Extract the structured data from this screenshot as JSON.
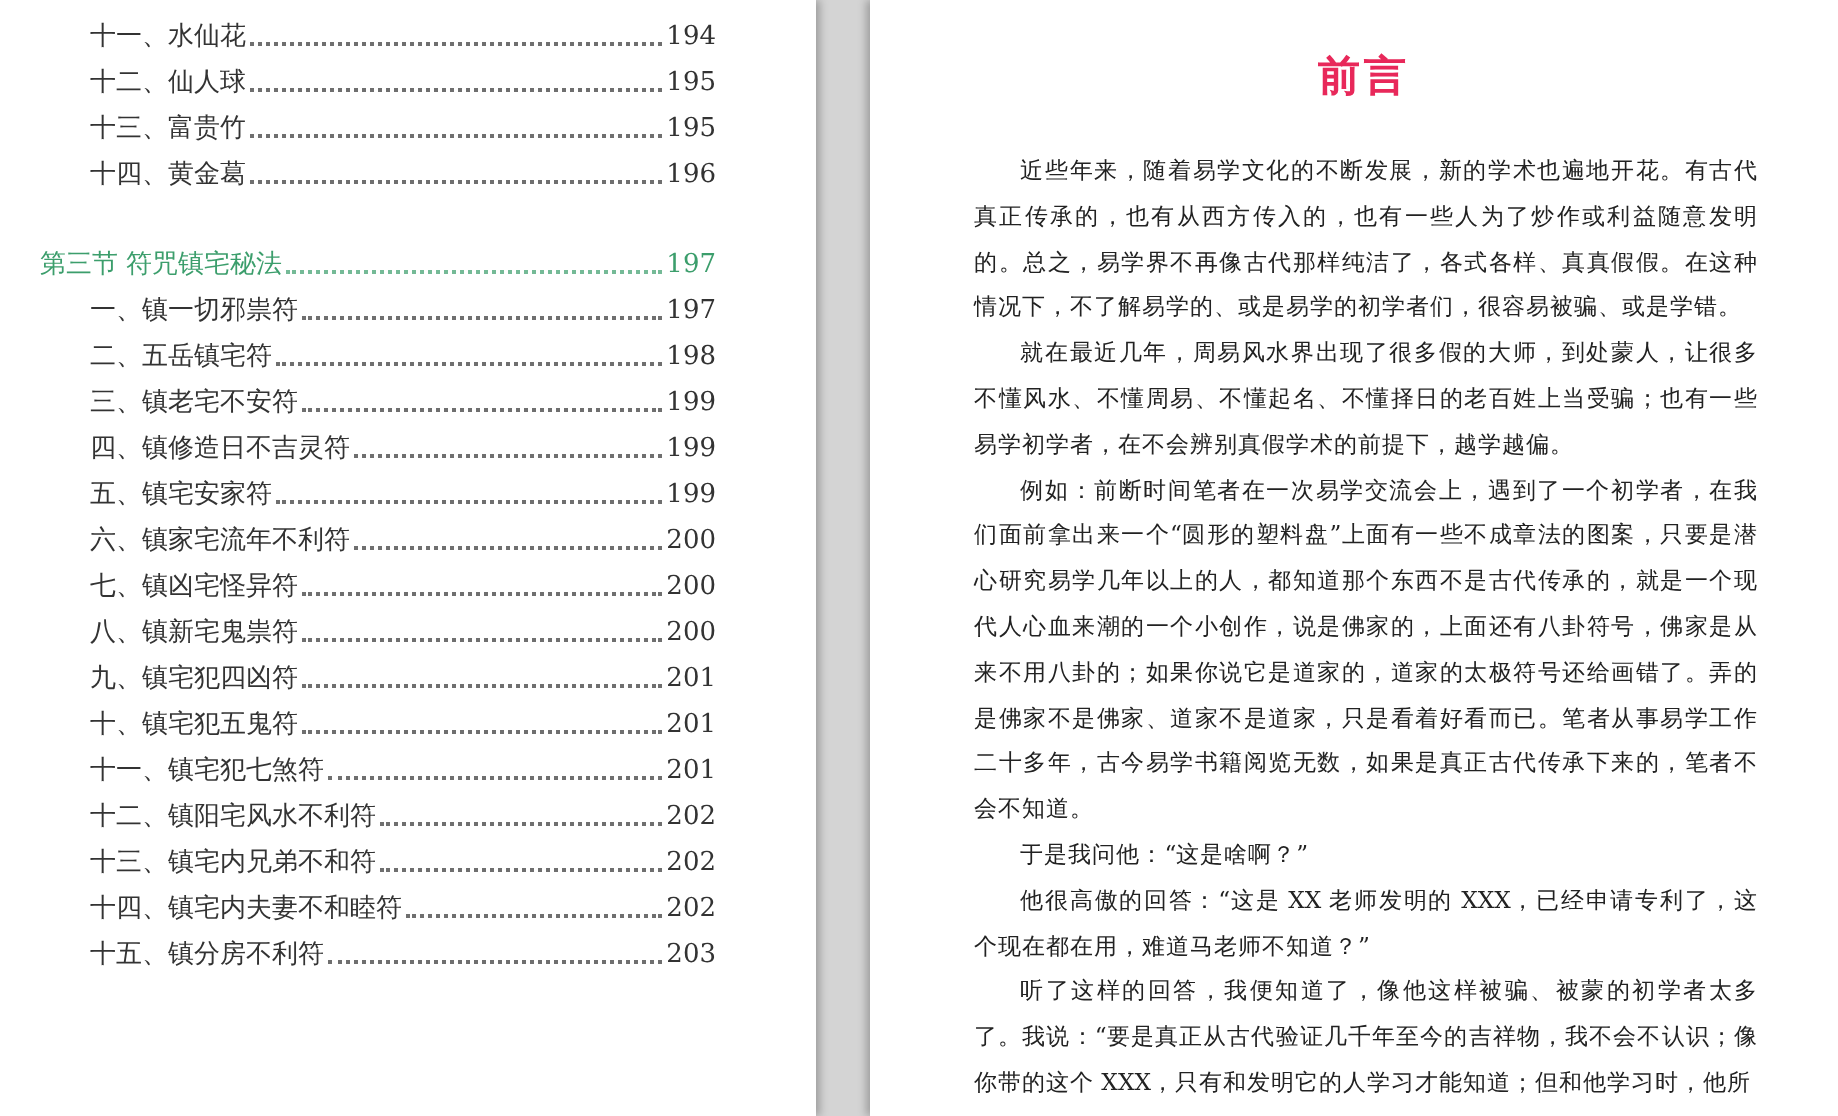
{
  "toc": [
    {
      "kind": "item",
      "title": "十一、水仙花",
      "page": "194"
    },
    {
      "kind": "item",
      "title": "十二、仙人球",
      "page": "195"
    },
    {
      "kind": "item",
      "title": "十三、富贵竹",
      "page": "195"
    },
    {
      "kind": "item",
      "title": "十四、黄金葛",
      "page": "196"
    },
    {
      "kind": "section",
      "title": "第三节  符咒镇宅秘法",
      "page": "197",
      "children": [
        {
          "kind": "item",
          "title": "一、镇一切邪祟符",
          "page": "197"
        },
        {
          "kind": "item",
          "title": "二、五岳镇宅符",
          "page": "198"
        },
        {
          "kind": "item",
          "title": "三、镇老宅不安符",
          "page": "199"
        },
        {
          "kind": "item",
          "title": "四、镇修造日不吉灵符",
          "page": "199"
        },
        {
          "kind": "item",
          "title": "五、镇宅安家符",
          "page": "199"
        },
        {
          "kind": "item",
          "title": "六、镇家宅流年不利符",
          "page": "200"
        },
        {
          "kind": "item",
          "title": "七、镇凶宅怪异符",
          "page": "200"
        },
        {
          "kind": "item",
          "title": "八、镇新宅鬼祟符",
          "page": "200"
        },
        {
          "kind": "item",
          "title": "九、镇宅犯四凶符",
          "page": "201"
        },
        {
          "kind": "item",
          "title": "十、镇宅犯五鬼符",
          "page": "201"
        },
        {
          "kind": "item",
          "title": "十一、镇宅犯七煞符",
          "page": "201"
        },
        {
          "kind": "item",
          "title": "十二、镇阳宅风水不利符",
          "page": "202"
        },
        {
          "kind": "item",
          "title": "十三、镇宅内兄弟不和符",
          "page": "202"
        },
        {
          "kind": "item",
          "title": "十四、镇宅内夫妻不和睦符",
          "page": "202"
        },
        {
          "kind": "item",
          "title": "十五、镇分房不利符",
          "page": "203"
        }
      ]
    }
  ],
  "preface": {
    "title": "前言",
    "paragraphs": [
      "近些年来，随着易学文化的不断发展，新的学术也遍地开花。有古代真正传承的，也有从西方传入的，也有一些人为了炒作或利益随意发明的。总之，易学界不再像古代那样纯洁了，各式各样、真真假假。在这种情况下，不了解易学的、或是易学的初学者们，很容易被骗、或是学错。",
      "就在最近几年，周易风水界出现了很多假的大师，到处蒙人，让很多不懂风水、不懂周易、不懂起名、不懂择日的老百姓上当受骗；也有一些易学初学者，在不会辨别真假学术的前提下，越学越偏。",
      "例如：前断时间笔者在一次易学交流会上，遇到了一个初学者，在我们面前拿出来一个“圆形的塑料盘”上面有一些不成章法的图案，只要是潜心研究易学几年以上的人，都知道那个东西不是古代传承的，就是一个现代人心血来潮的一个小创作，说是佛家的，上面还有八卦符号，佛家是从来不用八卦的；如果你说它是道家的，道家的太极符号还给画错了。弄的是佛家不是佛家、道家不是道家，只是看着好看而已。笔者从事易学工作二十多年，古今易学书籍阅览无数，如果是真正古代传承下来的，笔者不会不知道。",
      "于是我问他：“这是啥啊？”",
      "他很高傲的回答：“这是 XX 老师发明的 XXX，已经申请专利了，这个现在都在用，难道马老师不知道？”",
      "听了这样的回答，我便知道了，像他这样被骗、被蒙的初学者太多了。我说：“要是真正从古代验证几千年至今的吉祥物，我不会不认识；像你带的这个 XXX，只有和发明它的人学习才能知道；但和他学习时，他所"
    ]
  }
}
